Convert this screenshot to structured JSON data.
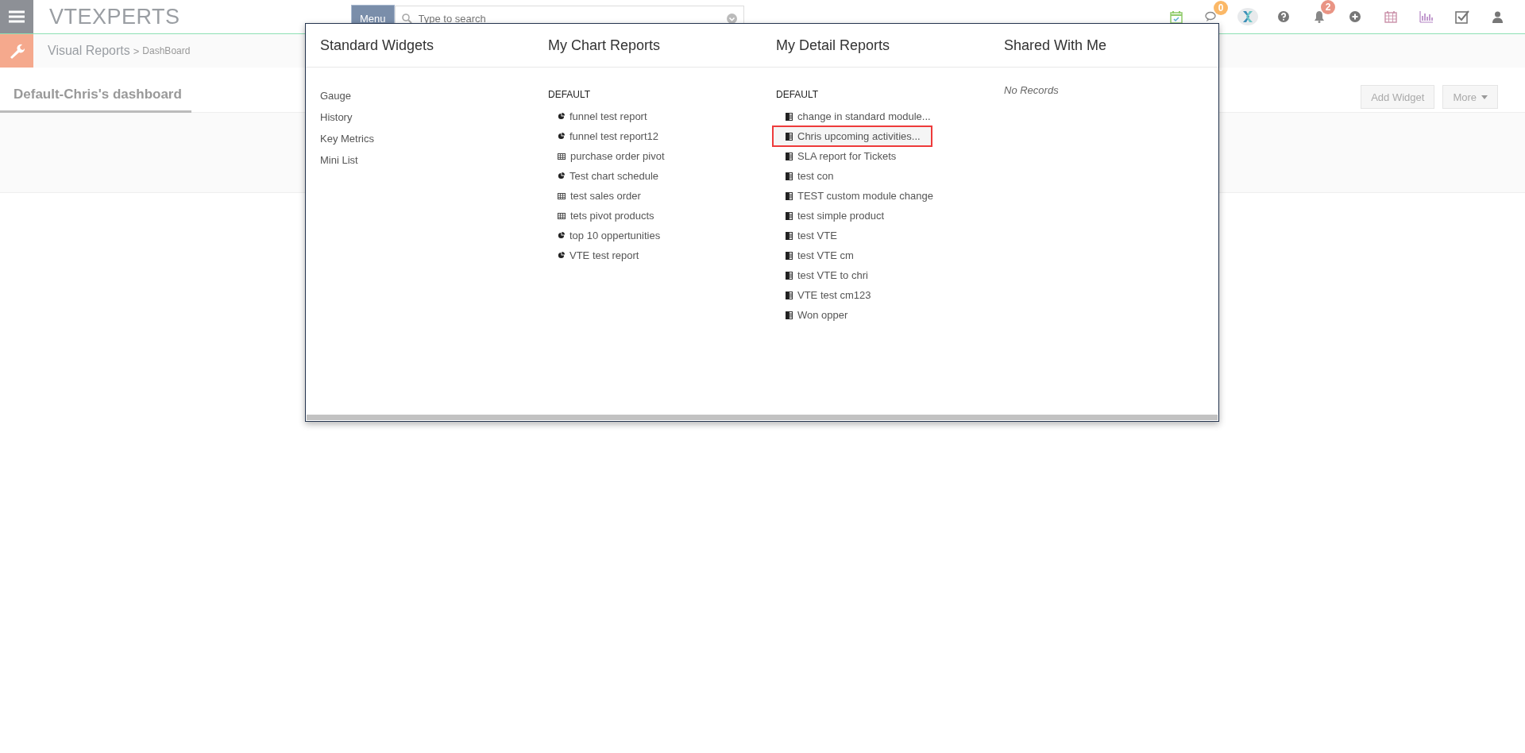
{
  "header": {
    "logo": "VTEXPERTS",
    "menu_button": "Menu",
    "search": {
      "placeholder": "Type to search"
    },
    "chat_badge": "0",
    "notification_badge": "2"
  },
  "breadcrumb": {
    "module": "Visual Reports",
    "separator": ">",
    "page": "DashBoard"
  },
  "dashboard_tabs": [
    {
      "label": "Default-Chris's dashboard",
      "selected": true
    }
  ],
  "actions": {
    "add_widget": "Add Widget",
    "more": "More"
  },
  "dropdown": {
    "columns": [
      {
        "title": "Standard Widgets",
        "groups": [
          {
            "items": [
              {
                "label": "Gauge"
              },
              {
                "label": "History"
              },
              {
                "label": "Key Metrics"
              },
              {
                "label": "Mini List"
              }
            ]
          }
        ]
      },
      {
        "title": "My Chart Reports",
        "groups": [
          {
            "name": "DEFAULT",
            "items": [
              {
                "label": "funnel test report",
                "kind": "chart"
              },
              {
                "label": "funnel test report12",
                "kind": "chart"
              },
              {
                "label": "purchase order pivot",
                "kind": "pivot"
              },
              {
                "label": "Test chart schedule",
                "kind": "chart"
              },
              {
                "label": "test sales order",
                "kind": "pivot"
              },
              {
                "label": "tets pivot products",
                "kind": "pivot"
              },
              {
                "label": "top 10 oppertunities",
                "kind": "chart"
              },
              {
                "label": "VTE test report",
                "kind": "chart"
              }
            ]
          }
        ]
      },
      {
        "title": "My Detail Reports",
        "groups": [
          {
            "name": "DEFAULT",
            "items": [
              {
                "label": "change in standard module...",
                "kind": "detail",
                "selected": false
              },
              {
                "label": "Chris upcoming activities...",
                "kind": "detail",
                "selected": true
              },
              {
                "label": "SLA report for Tickets",
                "kind": "detail",
                "selected": false
              },
              {
                "label": "test con",
                "kind": "detail",
                "selected": false
              },
              {
                "label": "TEST custom module change",
                "kind": "detail",
                "selected": false
              },
              {
                "label": "test simple product",
                "kind": "detail",
                "selected": false
              },
              {
                "label": "test VTE",
                "kind": "detail",
                "selected": false
              },
              {
                "label": "test VTE cm",
                "kind": "detail",
                "selected": false
              },
              {
                "label": "test VTE to chri",
                "kind": "detail",
                "selected": false
              },
              {
                "label": "VTE test cm123",
                "kind": "detail",
                "selected": false
              },
              {
                "label": "Won opper",
                "kind": "detail",
                "selected": false
              }
            ]
          }
        ]
      },
      {
        "title": "Shared With Me",
        "empty_text": "No Records"
      }
    ]
  }
}
